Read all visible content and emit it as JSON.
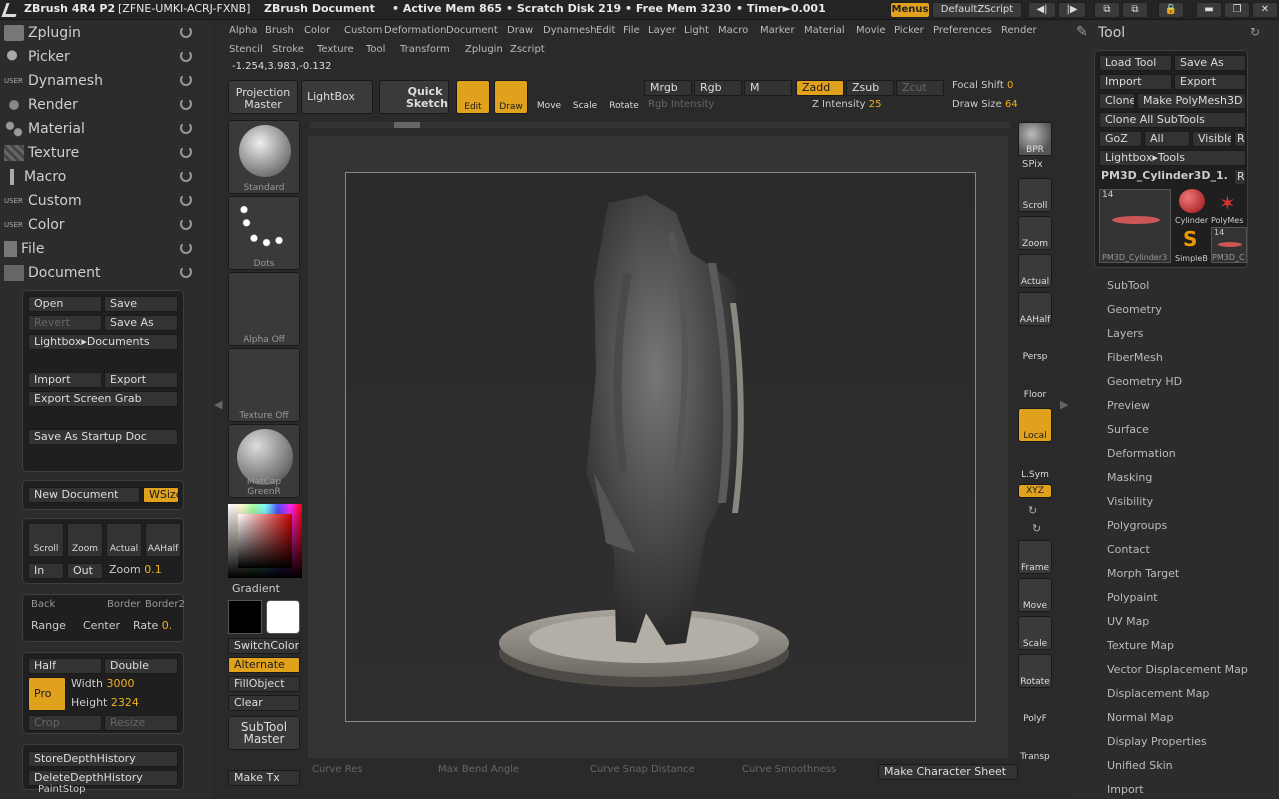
{
  "titlebar": {
    "app": "ZBrush 4R4 P2",
    "serial": "[ZFNE-UMKI-ACRJ-FXNB]",
    "doc": "ZBrush Document",
    "active_mem": "• Active Mem 865",
    "scratch": "• Scratch Disk 219",
    "free_mem": "• Free Mem 3230",
    "timer": "• Timer►0.001",
    "menus": "Menus",
    "script": "DefaultZScript"
  },
  "left_menus": [
    "Zplugin",
    "Picker",
    "Dynamesh",
    "Render",
    "Material",
    "Texture",
    "Macro",
    "Custom",
    "Color",
    "File",
    "Document"
  ],
  "user_prefix": "USER",
  "document": {
    "open": "Open",
    "save": "Save",
    "revert": "Revert",
    "save_as": "Save As",
    "lightbox_docs": "Lightbox▸Documents",
    "import": "Import",
    "export": "Export",
    "export_grab": "Export Screen Grab",
    "save_startup": "Save As Startup Doc",
    "new_doc": "New Document",
    "wsize": "WSize",
    "scroll": "Scroll",
    "zoom": "Zoom",
    "actual": "Actual",
    "aahalf": "AAHalf",
    "in": "In",
    "out": "Out",
    "zoom_label": "Zoom",
    "zoom_val": "0.1",
    "back": "Back",
    "border": "Border",
    "border2": "Border2",
    "range": "Range",
    "center": "Center",
    "rate": "Rate",
    "rate_val": "0.",
    "half": "Half",
    "double": "Double",
    "pro": "Pro",
    "width_label": "Width",
    "width_val": "3000",
    "height_label": "Height",
    "height_val": "2324",
    "crop": "Crop",
    "resize": "Resize",
    "store_depth": "StoreDepthHistory",
    "delete_depth": "DeleteDepthHistory",
    "paintstop": "PaintStop"
  },
  "top_menu_row1": [
    "Alpha",
    "Brush",
    "Color",
    "Custom",
    "Deformation",
    "Document",
    "Draw",
    "Dynamesh",
    "Edit",
    "File",
    "Layer",
    "Light",
    "Macro",
    "Marker",
    "Material",
    "Movie",
    "Picker",
    "Preferences",
    "Render"
  ],
  "top_menu_row2": [
    "Stencil",
    "Stroke",
    "Texture",
    "Tool",
    "Transform",
    "Zplugin",
    "Zscript"
  ],
  "coords": "-1.254,3.983,-0.132",
  "toolbar": {
    "projection_master": "Projection Master",
    "lightbox": "LightBox",
    "quick_sketch": "Quick Sketch",
    "edit": "Edit",
    "draw": "Draw",
    "move": "Move",
    "scale": "Scale",
    "rotate": "Rotate",
    "mrgb": "Mrgb",
    "rgb": "Rgb",
    "m": "M",
    "zadd": "Zadd",
    "zsub": "Zsub",
    "zcut": "Zcut",
    "rgb_intensity": "Rgb Intensity",
    "z_intensity_label": "Z Intensity",
    "z_intensity_val": "25",
    "focal_label": "Focal Shift",
    "focal_val": "0",
    "draw_size_label": "Draw Size",
    "draw_size_val": "64"
  },
  "shelf": {
    "standard": "Standard",
    "dots": "Dots",
    "alpha_off": "Alpha Off",
    "texture_off": "Texture Off",
    "matcap": "MatCap GreenR",
    "gradient": "Gradient",
    "switchcolor": "SwitchColor",
    "alternate": "Alternate",
    "fillobject": "FillObject",
    "clear": "Clear",
    "subtool_master": "SubTool Master",
    "make_tx": "Make Tx"
  },
  "right_shelf": [
    "BPR",
    "SPix",
    "Scroll",
    "Zoom",
    "Actual",
    "AAHalf",
    "Persp",
    "Floor",
    "Local",
    "L.Sym",
    "XYZ",
    "Frame",
    "Move",
    "Scale",
    "Rotate",
    "PolyF",
    "Transp"
  ],
  "bottom": {
    "curve_res": "Curve Res",
    "max_bend": "Max Bend Angle",
    "snap": "Curve Snap Distance",
    "smooth": "Curve Smoothness",
    "make_char": "Make Character Sheet"
  },
  "tool": {
    "title": "Tool",
    "load_tool": "Load Tool",
    "save_as": "Save As",
    "import": "Import",
    "export": "Export",
    "clone": "Clone",
    "make_polymesh": "Make PolyMesh3D",
    "clone_all": "Clone All SubTools",
    "goz": "GoZ",
    "all": "All",
    "visible": "Visible",
    "r": "R",
    "lightbox_tools": "Lightbox▸Tools",
    "current": "PM3D_Cylinder3D_1.",
    "thumb_count": "14",
    "thumb_main": "PM3D_Cylinder3",
    "cylinder": "Cylinder",
    "polymesh": "PolyMes",
    "simplebrush": "SimpleB",
    "pm3d": "PM3D_C",
    "subpalettes": [
      "SubTool",
      "Geometry",
      "Layers",
      "FiberMesh",
      "Geometry HD",
      "Preview",
      "Surface",
      "Deformation",
      "Masking",
      "Visibility",
      "Polygroups",
      "Contact",
      "Morph Target",
      "Polypaint",
      "UV Map",
      "Texture Map",
      "Vector Displacement Map",
      "Displacement Map",
      "Normal Map",
      "Display Properties",
      "Unified Skin",
      "Import"
    ]
  },
  "colors": {
    "accent": "#e0a21c",
    "bg": "#2a2a2a"
  }
}
